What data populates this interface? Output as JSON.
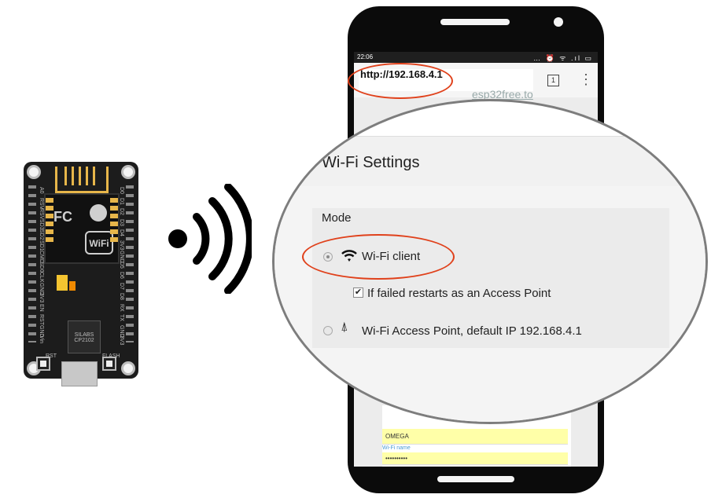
{
  "board": {
    "silkscreen_left": [
      "A0",
      "RSV",
      "RSV",
      "SD3",
      "SD2",
      "SD1",
      "CMD",
      "SD0",
      "CLK",
      "GND",
      "3V3",
      "EN",
      "RST",
      "GND",
      "Vin"
    ],
    "silkscreen_right": [
      "D0",
      "D1",
      "D2",
      "D3",
      "D4",
      "3V3",
      "GND",
      "D5",
      "D6",
      "D7",
      "D8",
      "RX",
      "TX",
      "GND",
      "3V3"
    ],
    "chip_label": "SILABS CP2102",
    "module_label": "WiFi",
    "rst_label": "RST",
    "flash_label": "FLASH"
  },
  "phone": {
    "status_time": "22:06",
    "status_icons": "… ⏰ ᯤ .ıl ▭",
    "url": "http://192.168.4.1",
    "tab_count": "1",
    "menu_icon": "⋮",
    "background_text": "esp32free.to",
    "bg_form": {
      "field1_value": "OMEGA",
      "field1_label": "Wi-Fi name",
      "field2_value": "••••••••••"
    }
  },
  "zoom": {
    "title": "Wi-Fi Settings",
    "mode_label": "Mode",
    "options": [
      {
        "label": "Wi-Fi client",
        "selected": true,
        "icon": "wifi-icon"
      },
      {
        "label": "Wi-Fi Access Point, default IP 192.168.4.1",
        "selected": false,
        "icon": "antenna-tower-icon"
      }
    ],
    "checkbox_label": "If failed restarts as an Access Point",
    "checkbox_checked": true,
    "checkbox_mark": "✔",
    "tower_glyph": "⍋"
  },
  "colors": {
    "highlight": "#e0411b",
    "board": "#1c1c1c",
    "phone": "#0b0b0b",
    "field_yellow": "#ffffa8"
  }
}
